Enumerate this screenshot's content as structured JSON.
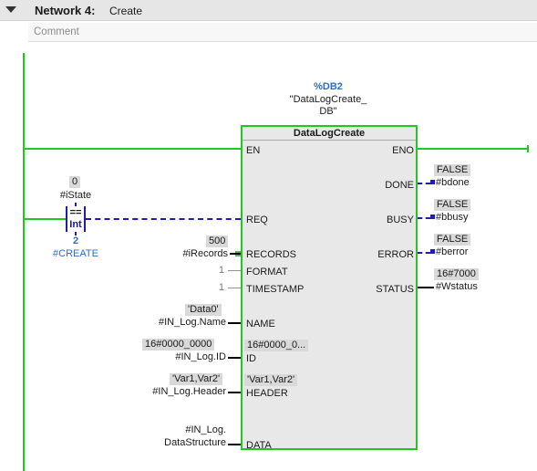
{
  "network": {
    "label": "Network 4:",
    "name": "Create",
    "comment_placeholder": "Comment"
  },
  "instance": {
    "db": "%DB2",
    "name_line1": "\"DataLogCreate_",
    "name_line2": "DB\""
  },
  "block": {
    "title": "DataLogCreate",
    "inputs": [
      "EN",
      "REQ",
      "RECORDS",
      "FORMAT",
      "TIMESTAMP",
      "NAME",
      "ID",
      "HEADER",
      "DATA"
    ],
    "outputs": [
      "ENO",
      "DONE",
      "BUSY",
      "ERROR",
      "STATUS"
    ],
    "id_inner_value": "16#0000_0...",
    "header_inner_value": "'Var1,Var2'"
  },
  "contact": {
    "value": "0",
    "operand_top": "#iState",
    "operator": "==",
    "type": "Int",
    "value_bottom": "2",
    "operand_bottom": "#CREATE"
  },
  "params": {
    "records_value": "500",
    "records_operand": "#iRecords",
    "format_value": "1",
    "timestamp_value": "1",
    "name_value": "'Data0'",
    "name_operand": "#IN_Log.Name",
    "id_value": "16#0000_0000",
    "id_operand": "#IN_Log.ID",
    "header_value": "'Var1,Var2'",
    "header_operand": "#IN_Log.Header",
    "data_operand_line1": "#IN_Log.",
    "data_operand_line2": "DataStructure"
  },
  "outputs": {
    "done_value": "FALSE",
    "done_operand": "#bdone",
    "busy_value": "FALSE",
    "busy_operand": "#bbusy",
    "error_value": "FALSE",
    "error_operand": "#berror",
    "status_value": "16#7000",
    "status_operand": "#Wstatus"
  },
  "colors": {
    "powerflow": "#21c821",
    "wire_blue": "#1e1ea8",
    "header_bg": "#e6e6e6",
    "block_bg": "#e8e8e8"
  }
}
